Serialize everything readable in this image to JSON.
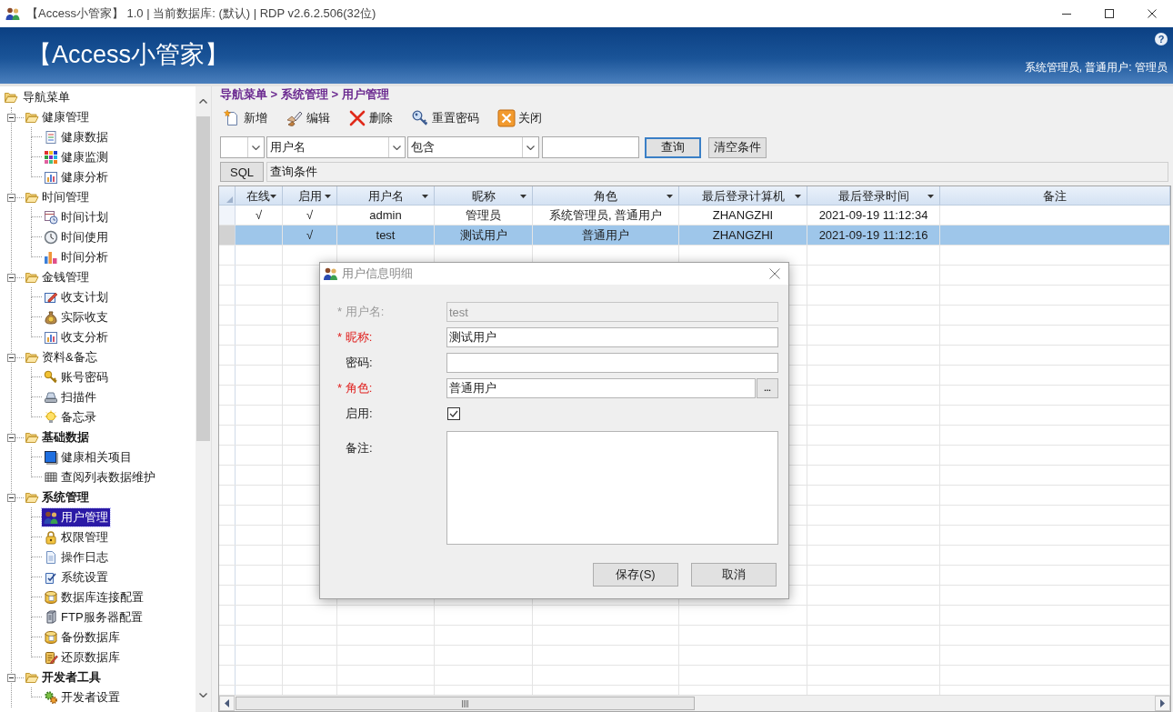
{
  "window": {
    "title": "【Access小管家】 1.0 | 当前数据库: (默认) | RDP v2.6.2.506(32位)"
  },
  "banner": {
    "title": "【Access小管家】",
    "help": "?",
    "user": "系统管理员, 普通用户: 管理员"
  },
  "tree": {
    "label": "导航菜单",
    "selected": false,
    "children": [
      {
        "label": "健康管理",
        "expanded": true,
        "bold": false,
        "selected": false,
        "children": [
          {
            "label": "健康数据",
            "selected": false
          },
          {
            "label": "健康监测",
            "selected": false
          },
          {
            "label": "健康分析",
            "selected": false
          }
        ]
      },
      {
        "label": "时间管理",
        "expanded": true,
        "bold": false,
        "selected": false,
        "children": [
          {
            "label": "时间计划",
            "selected": false
          },
          {
            "label": "时间使用",
            "selected": false
          },
          {
            "label": "时间分析",
            "selected": false
          }
        ]
      },
      {
        "label": "金钱管理",
        "expanded": true,
        "bold": false,
        "selected": false,
        "children": [
          {
            "label": "收支计划",
            "selected": false
          },
          {
            "label": "实际收支",
            "selected": false
          },
          {
            "label": "收支分析",
            "selected": false
          }
        ]
      },
      {
        "label": "资料&备忘",
        "expanded": true,
        "bold": false,
        "selected": false,
        "children": [
          {
            "label": "账号密码",
            "selected": false
          },
          {
            "label": "扫描件",
            "selected": false
          },
          {
            "label": "备忘录",
            "selected": false
          }
        ]
      },
      {
        "label": "基础数据",
        "expanded": true,
        "bold": true,
        "selected": false,
        "children": [
          {
            "label": "健康相关项目",
            "selected": false
          },
          {
            "label": "查阅列表数据维护",
            "selected": false
          }
        ]
      },
      {
        "label": "系统管理",
        "expanded": true,
        "bold": true,
        "selected": false,
        "children": [
          {
            "label": "用户管理",
            "selected": true
          },
          {
            "label": "权限管理",
            "selected": false
          },
          {
            "label": "操作日志",
            "selected": false
          },
          {
            "label": "系统设置",
            "selected": false
          },
          {
            "label": "数据库连接配置",
            "selected": false
          },
          {
            "label": "FTP服务器配置",
            "selected": false
          },
          {
            "label": "备份数据库",
            "selected": false
          },
          {
            "label": "还原数据库",
            "selected": false
          }
        ]
      },
      {
        "label": "开发者工具",
        "expanded": true,
        "bold": true,
        "selected": false,
        "children": [
          {
            "label": "开发者设置",
            "selected": false
          }
        ]
      }
    ]
  },
  "breadcrumb": "导航菜单 > 系统管理 > 用户管理",
  "toolbar": [
    "新增",
    "编辑",
    "删除",
    "重置密码",
    "关闭"
  ],
  "query_bar": {
    "controls": [
      {
        "kind": "combo"
      },
      {
        "kind": "combo",
        "value": "用户名"
      },
      {
        "kind": "combo",
        "value": "包含"
      },
      {
        "kind": "input"
      },
      {
        "kind": "button",
        "label": "查询",
        "focused": true
      },
      {
        "kind": "button",
        "label": "清空条件",
        "focused": false
      }
    ]
  },
  "sql_bar": {
    "button": "SQL",
    "condition": "查询条件"
  },
  "grid": {
    "columns": [
      {
        "title": "在线",
        "filter": true
      },
      {
        "title": "启用",
        "filter": true
      },
      {
        "title": "用户名",
        "filter": true
      },
      {
        "title": "昵称",
        "filter": true
      },
      {
        "title": "角色",
        "filter": true
      },
      {
        "title": "最后登录计算机",
        "filter": true
      },
      {
        "title": "最后登录时间",
        "filter": true
      },
      {
        "title": "备注",
        "filter": false
      }
    ],
    "rows": [
      {
        "selected": false,
        "cells": [
          "√",
          "√",
          "admin",
          "管理员",
          "系统管理员, 普通用户",
          "ZHANGZHI",
          "2021-09-19 11:12:34"
        ]
      },
      {
        "selected": true,
        "cells": [
          null,
          "√",
          "test",
          "测试用户",
          "普通用户",
          "ZHANGZHI",
          "2021-09-19 11:12:16"
        ]
      }
    ]
  },
  "dialog": {
    "title": "用户信息明细",
    "fields": [
      {
        "kind": "text",
        "label": "* 用户名:",
        "required": true,
        "disabled": true,
        "value": "test"
      },
      {
        "kind": "text",
        "label": "* 昵称:",
        "required": true,
        "disabled": false,
        "value": "测试用户"
      },
      {
        "kind": "text",
        "label": "密码:",
        "required": false,
        "disabled": false
      },
      {
        "kind": "picker",
        "label": "* 角色:",
        "required": true,
        "disabled": false,
        "value": "普通用户",
        "button": "..."
      },
      {
        "kind": "checkbox",
        "label": "启用:",
        "required": false,
        "disabled": false,
        "checked": true
      },
      {
        "kind": "textarea",
        "label": "备注:",
        "required": false,
        "disabled": false
      }
    ],
    "buttons": [
      "保存(S)",
      "取消"
    ]
  }
}
